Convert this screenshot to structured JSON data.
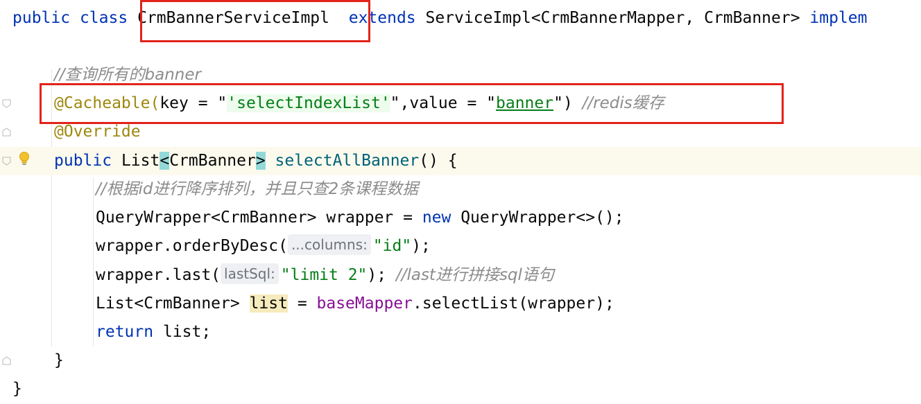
{
  "editor": {
    "line1": {
      "kw1": "public",
      "kw2": "class",
      "class_name": "CrmBannerServiceImpl",
      "kw3": "extends",
      "rest": "ServiceImpl<CrmBannerMapper, CrmBanner>",
      "kw4": "implem"
    },
    "line2_comment": "//查询所有的banner",
    "line3": {
      "annotation": "@Cacheable(",
      "key_part": "key = \"",
      "key_value": "'selectIndexList'",
      "mid": "\",value = \"",
      "value_value": "banner",
      "close": "\")",
      "comment": "//redis缓存"
    },
    "line4_annotation": "@Override",
    "line5": {
      "kw": "public",
      "type": "List",
      "lt": "<",
      "generic": "CrmBanner",
      "gt": ">",
      "method": "selectAllBanner",
      "rest": "() {"
    },
    "line6_comment": "//根据id进行降序排列，并且只查2条课程数据",
    "line7": {
      "decl": "QueryWrapper<CrmBanner> wrapper = ",
      "kw": "new",
      "rest": " QueryWrapper<>();"
    },
    "line8": {
      "pre": "wrapper.orderByDesc(",
      "hint": "...columns:",
      "arg": "\"id\"",
      "post": ");"
    },
    "line9": {
      "pre": "wrapper.last(",
      "hint": "lastSql:",
      "arg": "\"limit 2\"",
      "post": ");",
      "comment": "//last进行拼接sql语句"
    },
    "line10": {
      "type": "List<CrmBanner>",
      "var": "list",
      "eq": " = ",
      "field": "baseMapper",
      "rest": ".selectList(wrapper);"
    },
    "line11": {
      "kw": "return",
      "rest": " list;"
    },
    "line12": "}",
    "line13": "}"
  },
  "colors": {
    "highlight_box": "#e2231a",
    "keyword": "#0033b3",
    "annotation": "#9e880d",
    "comment": "#8c8c8c",
    "string": "#067d17"
  },
  "icons": [
    "fold-marker-icon",
    "lightbulb-icon"
  ]
}
